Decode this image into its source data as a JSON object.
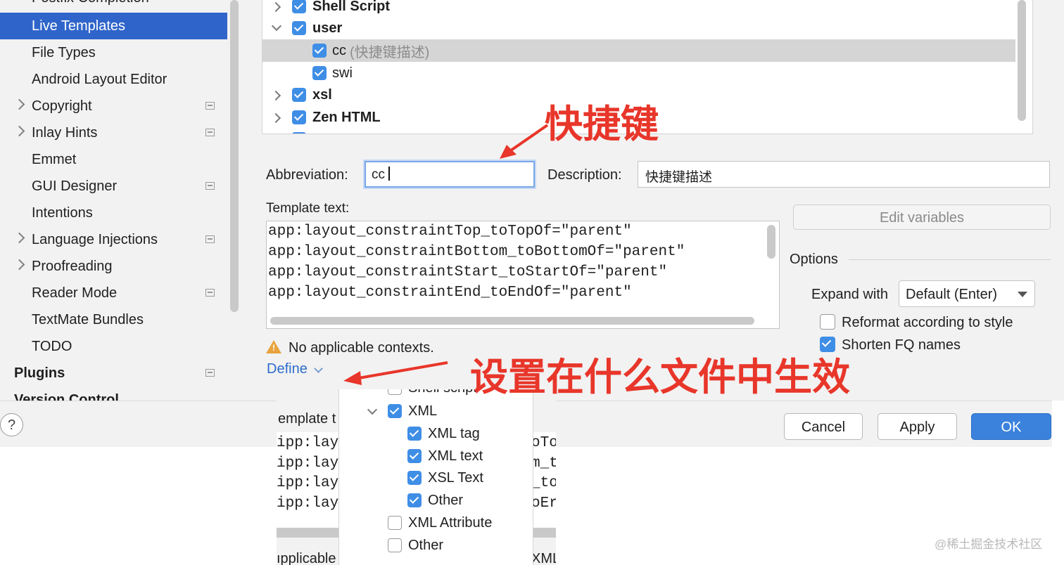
{
  "sidebar": {
    "top_cut_label": "Postfix Completion",
    "items": [
      {
        "label": "Live Templates",
        "selected": true
      },
      {
        "label": "File Types"
      },
      {
        "label": "Android Layout Editor"
      },
      {
        "label": "Copyright"
      },
      {
        "label": "Inlay Hints"
      },
      {
        "label": "Emmet"
      },
      {
        "label": "GUI Designer"
      },
      {
        "label": "Intentions"
      },
      {
        "label": "Language Injections"
      },
      {
        "label": "Proofreading"
      },
      {
        "label": "Reader Mode"
      },
      {
        "label": "TextMate Bundles"
      },
      {
        "label": "TODO"
      }
    ],
    "plugins": "Plugins",
    "version_control": "Version Control"
  },
  "tree": {
    "rows": [
      {
        "label": "Shell Script"
      },
      {
        "label": "user"
      },
      {
        "label": "cc",
        "desc": "(快捷键描述)"
      },
      {
        "label": "swi"
      },
      {
        "label": "xsl"
      },
      {
        "label": "Zen HTML"
      }
    ]
  },
  "form": {
    "abbreviation_label": "Abbreviation:",
    "abbreviation_value": "cc",
    "description_label": "Description:",
    "description_value": "快捷键描述",
    "template_text_label": "Template text:",
    "template_lines": [
      "app:layout_constraintTop_toTopOf=\"parent\"",
      "app:layout_constraintBottom_toBottomOf=\"parent\"",
      "app:layout_constraintStart_toStartOf=\"parent\"",
      "app:layout_constraintEnd_toEndOf=\"parent\""
    ],
    "edit_variables": "Edit variables",
    "options_label": "Options",
    "expand_with_label": "Expand with",
    "expand_with_value": "Default (Enter)",
    "reformat_label": "Reformat according to style",
    "shorten_label": "Shorten FQ names",
    "warning_text": "No applicable contexts.",
    "define_link": "Define"
  },
  "buttons": {
    "help": "?",
    "cancel": "Cancel",
    "apply": "Apply",
    "ok": "OK"
  },
  "popup": {
    "top_cut": "Shell script",
    "items": [
      {
        "label": "XML"
      },
      {
        "label": "XML tag"
      },
      {
        "label": "XML text"
      },
      {
        "label": "XSL Text"
      },
      {
        "label": "Other"
      },
      {
        "label": "XML Attribute"
      },
      {
        "label": "Other"
      }
    ],
    "bg_template_label": "emplate t",
    "bg_code_prefix": "ipp:lay",
    "bg_code_suffixes": [
      "oTo",
      "m_t",
      "_to",
      "oEr"
    ],
    "bg_applicable": "ıpplicable",
    "bg_xml": "XML"
  },
  "annotations": {
    "shortcut": "快捷键",
    "context": "设置在什么文件中生效",
    "color": "#e8362a"
  },
  "watermark": "@稀土掘金技术社区"
}
